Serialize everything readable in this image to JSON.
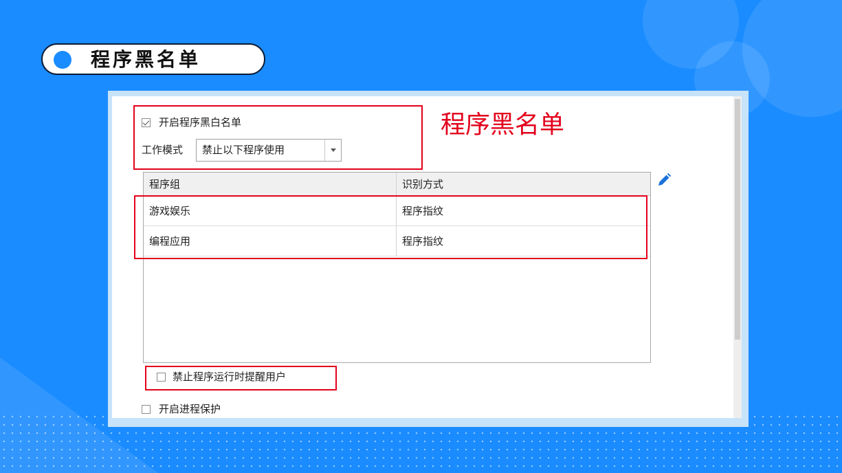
{
  "slide": {
    "title": "程序黑名单"
  },
  "annotation": "程序黑名单",
  "panel": {
    "enable_whitelist": {
      "label": "开启程序黑白名单",
      "checked": true
    },
    "work_mode": {
      "label": "工作模式",
      "selected": "禁止以下程序使用"
    },
    "table": {
      "columns": [
        "程序组",
        "识别方式"
      ],
      "rows": [
        [
          "游戏娱乐",
          "程序指纹"
        ],
        [
          "编程应用",
          "程序指纹"
        ]
      ]
    },
    "notify_user": {
      "label": "禁止程序运行时提醒用户",
      "checked": false
    },
    "process_protect": {
      "label": "开启进程保护",
      "checked": false
    }
  },
  "icons": {
    "edit": "pencil-icon"
  },
  "colors": {
    "background": "#1a8cff",
    "highlight": "#e3001b",
    "edit_icon": "#1a73d9"
  }
}
